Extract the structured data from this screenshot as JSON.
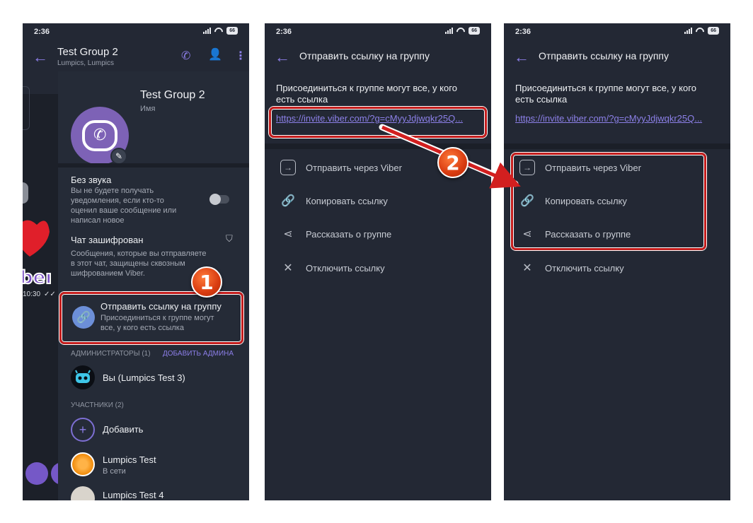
{
  "status_time": "2:36",
  "battery": "66",
  "panel1": {
    "header_title": "Test Group 2",
    "header_subtitle": "Lumpics, Lumpics",
    "group_name": "Test Group 2",
    "group_name_hint": "Имя",
    "mute_title": "Без звука",
    "mute_desc_1": "Вы не будете получать",
    "mute_desc_2": "уведомления, если кто-то",
    "mute_desc_3": "оценил ваше сообщение или",
    "mute_desc_4": "написал новое",
    "enc_title": "Чат зашифрован",
    "enc_desc_1": "Сообщения, которые вы отправляете",
    "enc_desc_2": "в этот чат, защищены сквозным",
    "enc_desc_3": "шифрованием Viber.",
    "send_link_title": "Отправить ссылку на группу",
    "send_link_desc_1": "Присоединиться к группе могут",
    "send_link_desc_2": "все, у кого есть ссылка",
    "admins_header": "АДМИНИСТРАТОРЫ (1)",
    "add_admin": "ДОБАВИТЬ АДМИНА",
    "admin_name": "Вы (Lumpics Test 3)",
    "members_header": "УЧАСТНИКИ (2)",
    "add_label": "Добавить",
    "member1_name": "Lumpics Test",
    "member1_status": "В сети",
    "member2_name": "Lumpics Test 4",
    "chat_time": "10:30",
    "badge": "1"
  },
  "panel2": {
    "header_title": "Отправить ссылку на группу",
    "info_1": "Присоединиться к группе могут все, у кого",
    "info_2": "есть ссылка",
    "link": "https://invite.viber.com/?g=cMyyJdjwqkr25Q...",
    "menu": [
      "Отправить через Viber",
      "Копировать ссылку",
      "Рассказать о группе",
      "Отключить ссылку"
    ],
    "badge": "2"
  },
  "panel3": {
    "header_title": "Отправить ссылку на группу",
    "info_1": "Присоединиться к группе могут все, у кого",
    "info_2": "есть ссылка",
    "link": "https://invite.viber.com/?g=cMyyJdjwqkr25Q...",
    "menu": [
      "Отправить через Viber",
      "Копировать ссылку",
      "Рассказать о группе",
      "Отключить ссылку"
    ]
  },
  "colors": {
    "accent": "#8c7ee8",
    "background": "#232834",
    "highlight": "#c41d1d"
  }
}
